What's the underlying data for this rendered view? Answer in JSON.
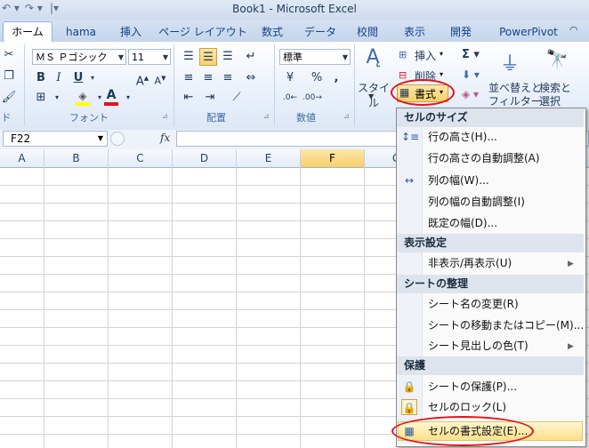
{
  "titlebar": {
    "title": "Book1 - Microsoft Excel"
  },
  "tabs": [
    "ホーム",
    "hama",
    "挿入",
    "ページ レイアウト",
    "数式",
    "データ",
    "校閲",
    "表示",
    "開発",
    "PowerPivot"
  ],
  "ribbon": {
    "font_name": "ＭＳ Ｐゴシック",
    "font_size": "11",
    "number_format": "標準",
    "style_label": "スタイル",
    "insert_label": "挿入",
    "delete_label": "削除",
    "format_label": "書式",
    "sort_label1": "並べ替えと",
    "sort_label2": "フィルター",
    "find_label1": "検索と",
    "find_label2": "選択",
    "groups": {
      "clipboard": "ド",
      "font": "フォント",
      "alignment": "配置",
      "number": "数値"
    }
  },
  "formula_bar": {
    "name_box": "F22",
    "fx": "fx"
  },
  "columns": [
    "A",
    "B",
    "C",
    "D",
    "E",
    "F",
    "G"
  ],
  "menu": {
    "section_cell_size": "セルのサイズ",
    "row_height": "行の高さ(H)...",
    "autofit_row": "行の高さの自動調整(A)",
    "col_width": "列の幅(W)...",
    "autofit_col": "列の幅の自動調整(I)",
    "default_width": "既定の幅(D)...",
    "section_visibility": "表示設定",
    "hide_unhide": "非表示/再表示(U)",
    "section_organize": "シートの整理",
    "rename_sheet": "シート名の変更(R)",
    "move_copy": "シートの移動またはコピー(M)...",
    "tab_color": "シート見出しの色(T)",
    "section_protection": "保護",
    "protect_sheet": "シートの保護(P)...",
    "lock_cell": "セルのロック(L)",
    "format_cells": "セルの書式設定(E)..."
  }
}
